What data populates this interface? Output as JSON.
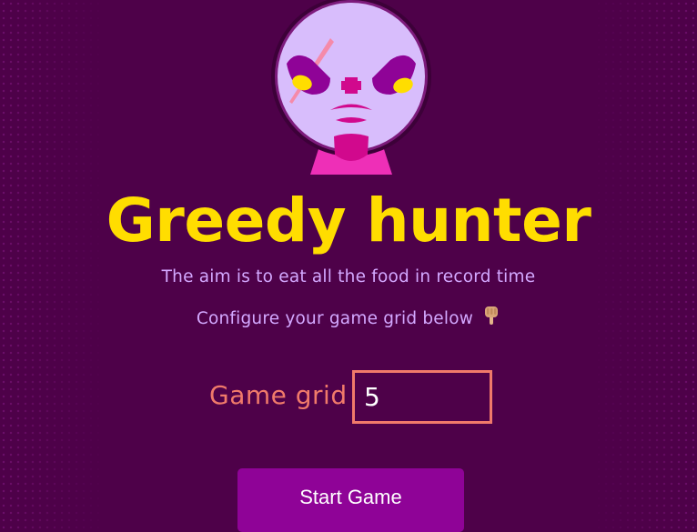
{
  "game": {
    "title": "Greedy hunter",
    "aim_text": "The aim is to eat all the food in record time",
    "configure_text": "Configure your game grid below",
    "pointer_icon": "backhand-index-pointing-down",
    "grid_label": "Game grid",
    "grid_value": "5",
    "start_button_label": "Start Game"
  },
  "mascot": {
    "icon": "angry-moon-face-mascot"
  },
  "theme": {
    "background": "#4e0149",
    "title_color": "#ffdd00",
    "text_color": "#d3a8ff",
    "label_color": "#f07a6a",
    "button_color": "#8f0397"
  }
}
